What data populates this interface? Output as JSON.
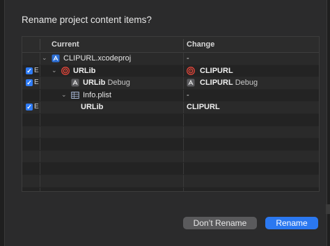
{
  "dialog": {
    "title": "Rename project content items?",
    "columns": {
      "current": "Current",
      "change": "Change"
    },
    "rows": [
      {
        "checked": false,
        "checkbox_label": "",
        "indent": 0,
        "chevron": "down",
        "icon": "xcodeproj-icon",
        "current": "CLIPURL.xcodeproj",
        "current_bold": false,
        "current_suffix": "",
        "change": "-",
        "change_icon": "",
        "change_bold": false,
        "change_suffix": ""
      },
      {
        "checked": true,
        "checkbox_label": "E",
        "indent": 1,
        "chevron": "down",
        "icon": "target-icon",
        "current": "URLib",
        "current_bold": true,
        "current_suffix": "",
        "change": "CLIPURL",
        "change_icon": "target-icon",
        "change_bold": true,
        "change_suffix": ""
      },
      {
        "checked": true,
        "checkbox_label": "E",
        "indent": 2,
        "chevron": "",
        "icon": "scheme-icon",
        "current": "URLib",
        "current_bold": true,
        "current_suffix": " Debug",
        "change": "CLIPURL",
        "change_icon": "scheme-icon",
        "change_bold": true,
        "change_suffix": " Debug"
      },
      {
        "checked": false,
        "checkbox_label": "",
        "indent": 2,
        "chevron": "down",
        "icon": "plist-icon",
        "current": "Info.plist",
        "current_bold": false,
        "current_suffix": "",
        "change": "-",
        "change_icon": "",
        "change_bold": false,
        "change_suffix": ""
      },
      {
        "checked": true,
        "checkbox_label": "E",
        "indent": 3,
        "chevron": "",
        "icon": "",
        "current": "URLib",
        "current_bold": true,
        "current_suffix": "",
        "change": "CLIPURL",
        "change_icon": "",
        "change_bold": true,
        "change_suffix": ""
      }
    ],
    "empty_rows": 8,
    "buttons": {
      "dont_rename": "Don’t Rename",
      "rename": "Rename"
    }
  }
}
